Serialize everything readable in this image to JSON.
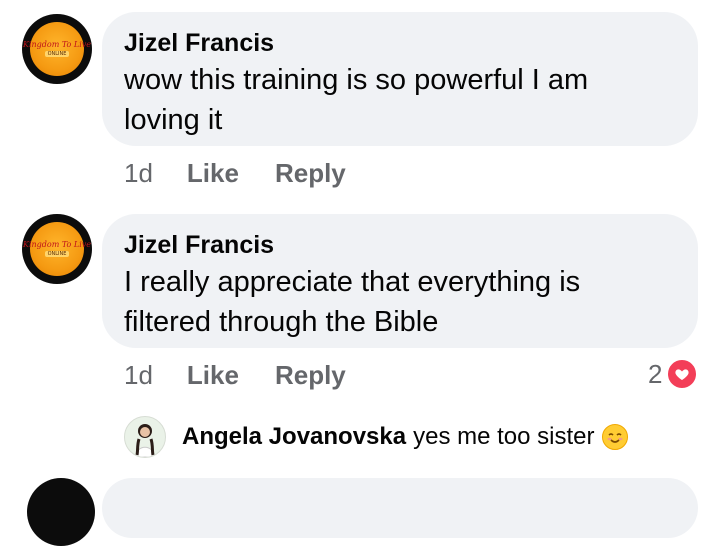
{
  "comments": [
    {
      "author": "Jizel Francis",
      "lines": [
        "wow this training is so powerful I am",
        "loving it"
      ],
      "time": "1d",
      "like_label": "Like",
      "reply_label": "Reply",
      "avatar_text": "Kingdom To Live",
      "avatar_subtext": "ONLINE"
    },
    {
      "author": "Jizel Francis",
      "lines": [
        "I really appreciate that everything is",
        "filtered through the Bible"
      ],
      "time": "1d",
      "like_label": "Like",
      "reply_label": "Reply",
      "reaction_count": "2",
      "reaction_icon": "heart-icon",
      "avatar_text": "Kingdom To Live",
      "avatar_subtext": "ONLINE"
    }
  ],
  "reply": {
    "author": "Angela Jovanovska",
    "text": "yes me too sister",
    "emoji": "smiling-face-icon"
  },
  "colors": {
    "bubble": "#f0f2f5",
    "meta_text": "#65676b",
    "heart": "#f33e58"
  }
}
